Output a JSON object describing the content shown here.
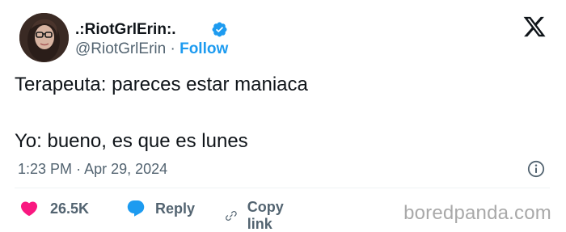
{
  "author": {
    "display_name": ".:RiotGrlErin:.",
    "handle": "@RiotGrlErin",
    "separator": "·",
    "follow_label": "Follow"
  },
  "tweet": {
    "line1": "Terapeuta: pareces estar maniaca",
    "line2": "Yo: bueno, es que es lunes",
    "time": "1:23 PM",
    "date": "Apr 29, 2024",
    "meta_separator": "·"
  },
  "actions": {
    "likes_count": "26.5K",
    "reply_label": "Reply",
    "copy_link_label": "Copy link"
  },
  "watermark": "boredpanda.com",
  "colors": {
    "like": "#f91880",
    "reply": "#1d9bf0",
    "follow": "#1d9bf0",
    "verified": "#1d9bf0",
    "muted": "#536471"
  },
  "icons": {
    "logo": "x-logo-icon",
    "verified": "verified-badge-icon",
    "info": "info-icon",
    "like": "heart-icon",
    "reply": "speech-bubble-icon",
    "copy_link": "link-icon"
  }
}
